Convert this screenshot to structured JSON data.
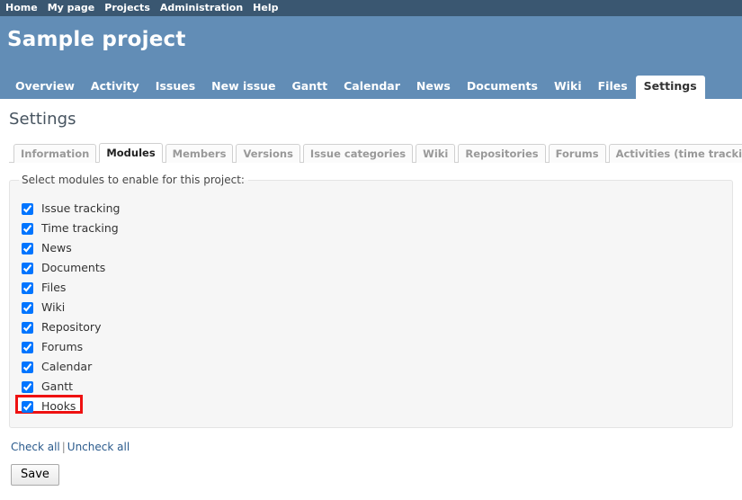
{
  "top_menu": {
    "items": [
      {
        "label": "Home"
      },
      {
        "label": "My page"
      },
      {
        "label": "Projects"
      },
      {
        "label": "Administration"
      },
      {
        "label": "Help"
      }
    ]
  },
  "header": {
    "project_title": "Sample project",
    "background_color": "#628db6",
    "top_bar_color": "#3a5771"
  },
  "main_menu": {
    "items": [
      {
        "label": "Overview",
        "selected": false
      },
      {
        "label": "Activity",
        "selected": false
      },
      {
        "label": "Issues",
        "selected": false
      },
      {
        "label": "New issue",
        "selected": false
      },
      {
        "label": "Gantt",
        "selected": false
      },
      {
        "label": "Calendar",
        "selected": false
      },
      {
        "label": "News",
        "selected": false
      },
      {
        "label": "Documents",
        "selected": false
      },
      {
        "label": "Wiki",
        "selected": false
      },
      {
        "label": "Files",
        "selected": false
      },
      {
        "label": "Settings",
        "selected": true
      }
    ]
  },
  "page": {
    "title": "Settings"
  },
  "settings_tabs": {
    "items": [
      {
        "label": "Information",
        "selected": false
      },
      {
        "label": "Modules",
        "selected": true
      },
      {
        "label": "Members",
        "selected": false
      },
      {
        "label": "Versions",
        "selected": false
      },
      {
        "label": "Issue categories",
        "selected": false
      },
      {
        "label": "Wiki",
        "selected": false
      },
      {
        "label": "Repositories",
        "selected": false
      },
      {
        "label": "Forums",
        "selected": false
      },
      {
        "label": "Activities (time tracking)",
        "selected": false
      }
    ]
  },
  "modules": {
    "legend": "Select modules to enable for this project:",
    "items": [
      {
        "label": "Issue tracking",
        "checked": true,
        "highlighted": false
      },
      {
        "label": "Time tracking",
        "checked": true,
        "highlighted": false
      },
      {
        "label": "News",
        "checked": true,
        "highlighted": false
      },
      {
        "label": "Documents",
        "checked": true,
        "highlighted": false
      },
      {
        "label": "Files",
        "checked": true,
        "highlighted": false
      },
      {
        "label": "Wiki",
        "checked": true,
        "highlighted": false
      },
      {
        "label": "Repository",
        "checked": true,
        "highlighted": false
      },
      {
        "label": "Forums",
        "checked": true,
        "highlighted": false
      },
      {
        "label": "Calendar",
        "checked": true,
        "highlighted": false
      },
      {
        "label": "Gantt",
        "checked": true,
        "highlighted": false
      },
      {
        "label": "Hooks",
        "checked": true,
        "highlighted": true
      }
    ],
    "highlight_color": "#ee1111"
  },
  "bulk_links": {
    "check_all": "Check all",
    "separator": "|",
    "uncheck_all": "Uncheck all"
  },
  "form": {
    "save_label": "Save"
  }
}
